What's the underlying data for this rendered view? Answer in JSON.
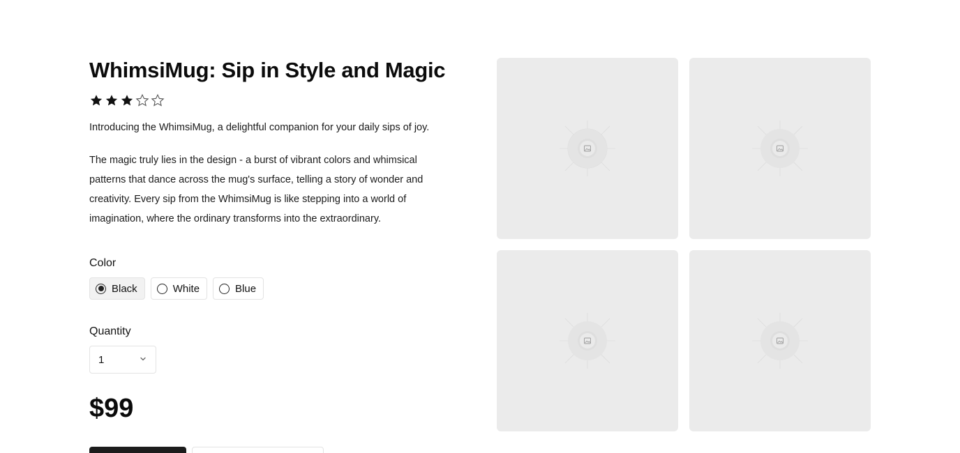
{
  "product": {
    "title": "WhimsiMug: Sip in Style and Magic",
    "rating": 3,
    "rating_max": 5,
    "intro": "Introducing the WhimsiMug, a delightful companion for your daily sips of joy.",
    "description": "The magic truly lies in the design - a burst of vibrant colors and whimsical patterns that dance across the mug's surface, telling a story of wonder and creativity. Every sip from the WhimsiMug is like stepping into a world of imagination, where the ordinary transforms into the extraordinary.",
    "price": "$99"
  },
  "color": {
    "label": "Color",
    "options": [
      {
        "label": "Black",
        "selected": true
      },
      {
        "label": "White",
        "selected": false
      },
      {
        "label": "Blue",
        "selected": false
      }
    ]
  },
  "quantity": {
    "label": "Quantity",
    "value": "1"
  },
  "icons": {
    "star_filled": "star-filled-icon",
    "star_empty": "star-outline-icon",
    "chevron": "chevron-down-icon",
    "image_placeholder": "image-placeholder-icon"
  },
  "colors": {
    "star": "#111111",
    "thumb_bg": "#ebebeb",
    "primary_button": "#1c1c1c"
  }
}
